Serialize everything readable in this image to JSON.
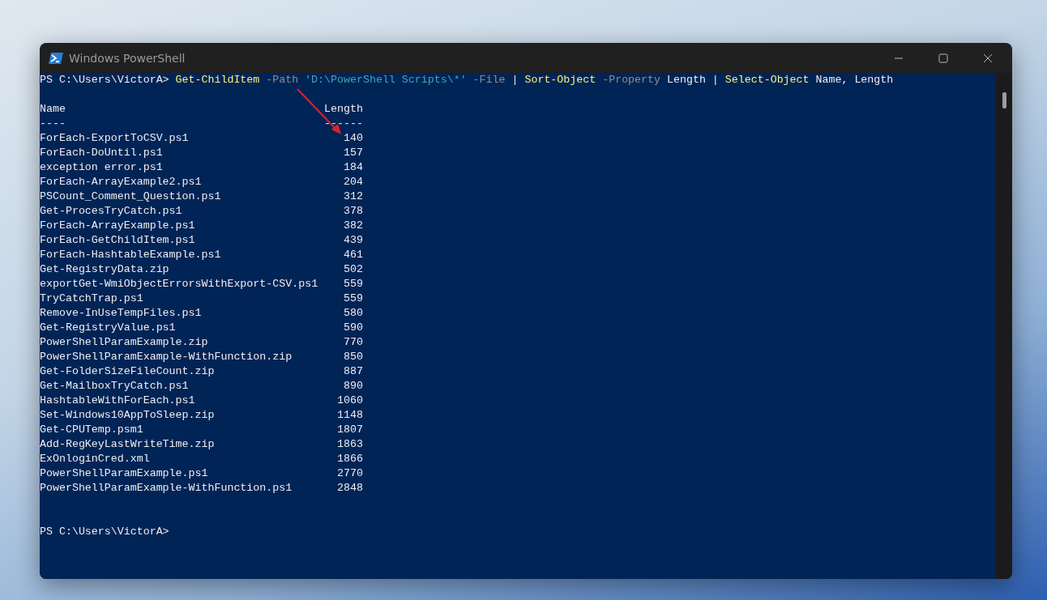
{
  "window": {
    "title": "Windows PowerShell"
  },
  "console": {
    "prompt": "PS C:\\Users\\VictorA>",
    "command": [
      {
        "text": "Get-ChildItem",
        "kind": "cmdlet"
      },
      {
        "text": "-Path",
        "kind": "param"
      },
      {
        "text": "'D:\\PowerShell Scripts\\*'",
        "kind": "string"
      },
      {
        "text": "-File",
        "kind": "param"
      },
      {
        "text": "|",
        "kind": "plain"
      },
      {
        "text": "Sort-Object",
        "kind": "cmdlet"
      },
      {
        "text": "-Property",
        "kind": "param"
      },
      {
        "text": "Length",
        "kind": "plain"
      },
      {
        "text": "|",
        "kind": "plain"
      },
      {
        "text": "Select-Object",
        "kind": "cmdlet"
      },
      {
        "text": "Name,",
        "kind": "plain"
      },
      {
        "text": "Length",
        "kind": "plain"
      }
    ],
    "columns": [
      {
        "header": "Name",
        "rule": "----"
      },
      {
        "header": "Length",
        "rule": "------"
      }
    ],
    "rows": [
      [
        "ForEach-ExportToCSV.ps1",
        "140"
      ],
      [
        "ForEach-DoUntil.ps1",
        "157"
      ],
      [
        "exception error.ps1",
        "184"
      ],
      [
        "ForEach-ArrayExample2.ps1",
        "204"
      ],
      [
        "PSCount_Comment_Question.ps1",
        "312"
      ],
      [
        "Get-ProcesTryCatch.ps1",
        "378"
      ],
      [
        "ForEach-ArrayExample.ps1",
        "382"
      ],
      [
        "ForEach-GetChildItem.ps1",
        "439"
      ],
      [
        "ForEach-HashtableExample.ps1",
        "461"
      ],
      [
        "Get-RegistryData.zip",
        "502"
      ],
      [
        "exportGet-WmiObjectErrorsWithExport-CSV.ps1",
        "559"
      ],
      [
        "TryCatchTrap.ps1",
        "559"
      ],
      [
        "Remove-InUseTempFiles.ps1",
        "580"
      ],
      [
        "Get-RegistryValue.ps1",
        "590"
      ],
      [
        "PowerShellParamExample.zip",
        "770"
      ],
      [
        "PowerShellParamExample-WithFunction.zip",
        "850"
      ],
      [
        "Get-FolderSizeFileCount.zip",
        "887"
      ],
      [
        "Get-MailboxTryCatch.ps1",
        "890"
      ],
      [
        "HashtableWithForEach.ps1",
        "1060"
      ],
      [
        "Set-Windows10AppToSleep.zip",
        "1148"
      ],
      [
        "Get-CPUTemp.psm1",
        "1807"
      ],
      [
        "Add-RegKeyLastWriteTime.zip",
        "1863"
      ],
      [
        "ExOnloginCred.xml",
        "1866"
      ],
      [
        "PowerShellParamExample.ps1",
        "2770"
      ],
      [
        "PowerShellParamExample-WithFunction.ps1",
        "2848"
      ]
    ],
    "final_prompt": "PS C:\\Users\\VictorA>"
  }
}
